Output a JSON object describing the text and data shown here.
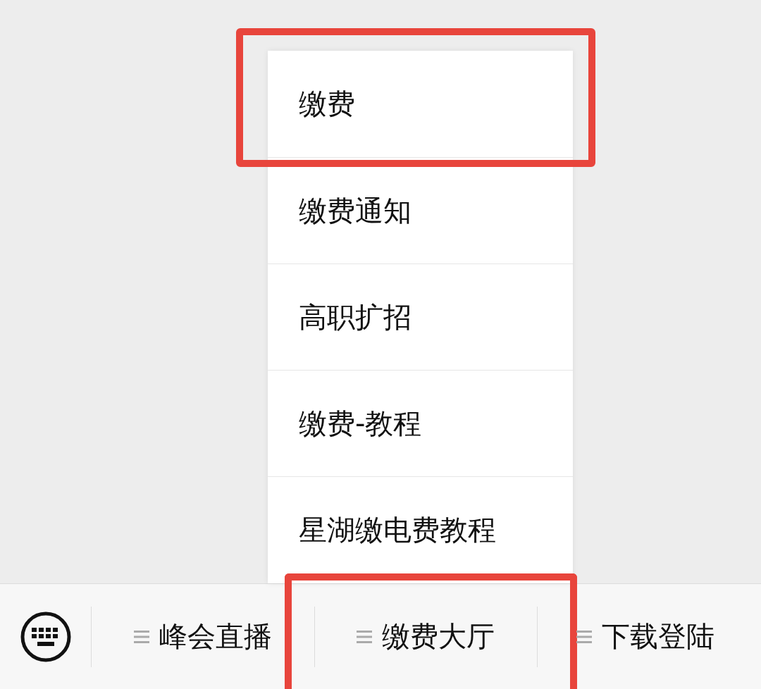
{
  "popup_menu": {
    "items": [
      {
        "label": "缴费",
        "highlighted": true
      },
      {
        "label": "缴费通知",
        "highlighted": false
      },
      {
        "label": "高职扩招",
        "highlighted": false
      },
      {
        "label": "缴费-教程",
        "highlighted": false
      },
      {
        "label": "星湖缴电费教程",
        "highlighted": false
      }
    ]
  },
  "bottom_menu": {
    "items": [
      {
        "label": "峰会直播",
        "highlighted": false
      },
      {
        "label": "缴费大厅",
        "highlighted": true
      },
      {
        "label": "下载登陆",
        "highlighted": false
      }
    ]
  }
}
